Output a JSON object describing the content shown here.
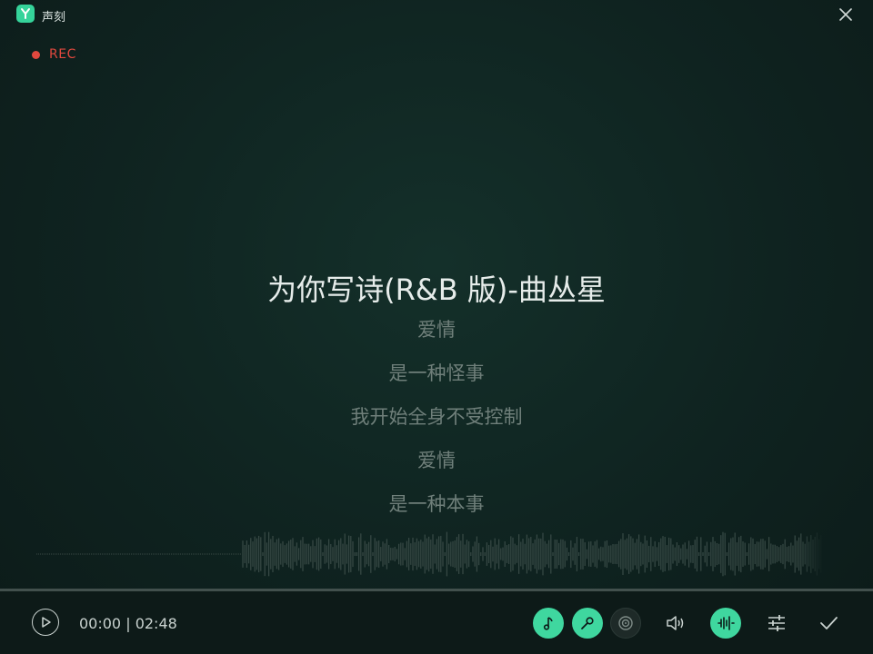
{
  "app": {
    "name": "声刻"
  },
  "recording": {
    "label": "REC"
  },
  "song": {
    "title": "为你写诗(R&B 版)-曲丛星",
    "lyrics": [
      "爱情",
      "是一种怪事",
      "我开始全身不受控制",
      "爱情",
      "是一种本事"
    ]
  },
  "player": {
    "current_time": "00:00",
    "separator": "|",
    "total_time": "02:48",
    "progress": 0
  },
  "toolbar": {
    "icons": [
      "music-note-icon",
      "microphone-icon",
      "disc-icon",
      "speaker-icon",
      "waveform-icon",
      "sliders-icon",
      "check-icon"
    ]
  },
  "colors": {
    "accent": "#3fd79f",
    "rec": "#e0483e",
    "background": "#0f2320"
  }
}
